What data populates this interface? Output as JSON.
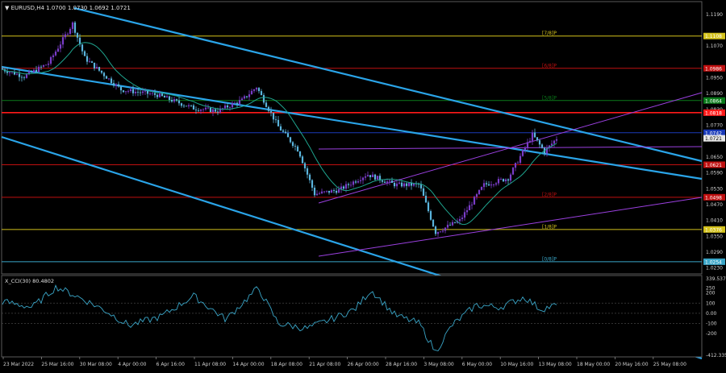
{
  "main": {
    "header": "▼ EURUSD,H4  1.0700 1.0730 1.0692 1.0721",
    "y_min": 1.022,
    "y_max": 1.122,
    "price_labels": [
      "1.1190",
      "1.1070",
      "1.0950",
      "1.0890",
      "1.0830",
      "1.0770",
      "1.0650",
      "1.0590",
      "1.0530",
      "1.0470",
      "1.0410",
      "1.0350",
      "1.0290",
      "1.0230"
    ],
    "levels": [
      {
        "label": "[7/8]P",
        "tag": "1.1108",
        "price": 1.1108,
        "color": "#d4c21c"
      },
      {
        "label": "[6/8]P",
        "tag": "1.0986",
        "price": 1.0986,
        "color": "#c01010"
      },
      {
        "label": "[5/8]P",
        "tag": "1.0864",
        "price": 1.0864,
        "color": "#0a7a1a"
      },
      {
        "label": "",
        "tag": "1.0742",
        "price": 1.0742,
        "color": "#1a3ab8"
      },
      {
        "label": "",
        "tag": "1.0621",
        "price": 1.0621,
        "color": "#c01010"
      },
      {
        "label": "[2/8]P",
        "tag": "1.0498",
        "price": 1.0498,
        "color": "#c01010"
      },
      {
        "label": "[1/8]P",
        "tag": "1.0376",
        "price": 1.0376,
        "color": "#d4c21c"
      },
      {
        "label": "[0/8]P",
        "tag": "1.0254",
        "price": 1.0254,
        "color": "#3aa6c8"
      }
    ],
    "current_price": "1.0721",
    "murray_red": {
      "price": 1.0818,
      "tag": "1.0818",
      "color": "#ff1a1a"
    }
  },
  "indicator": {
    "title": "X_CCI(30) 80.4802",
    "y_max": 339.5376,
    "y_min": -412.335,
    "labels": [
      "339.5376",
      "250",
      "200",
      "100",
      "0.00",
      "-100",
      "-200",
      "-412.335"
    ]
  },
  "time_axis": [
    "23 Mar 2022",
    "25 Mar 16:00",
    "30 Mar 08:00",
    "4 Apr 00:00",
    "6 Apr 16:00",
    "11 Apr 08:00",
    "14 Apr 00:00",
    "18 Apr 08:00",
    "21 Apr 08:00",
    "26 Apr 00:00",
    "28 Apr 16:00",
    "3 May 08:00",
    "6 May 00:00",
    "10 May 16:00",
    "13 May 08:00",
    "18 May 00:00",
    "20 May 16:00",
    "25 May 08:00"
  ],
  "colors": {
    "bull": "#7a3cc8",
    "bear": "#5ab4dc",
    "ma": "#1fa58f",
    "channel": "#2aa4e8",
    "fan": "#9b40e0"
  }
}
